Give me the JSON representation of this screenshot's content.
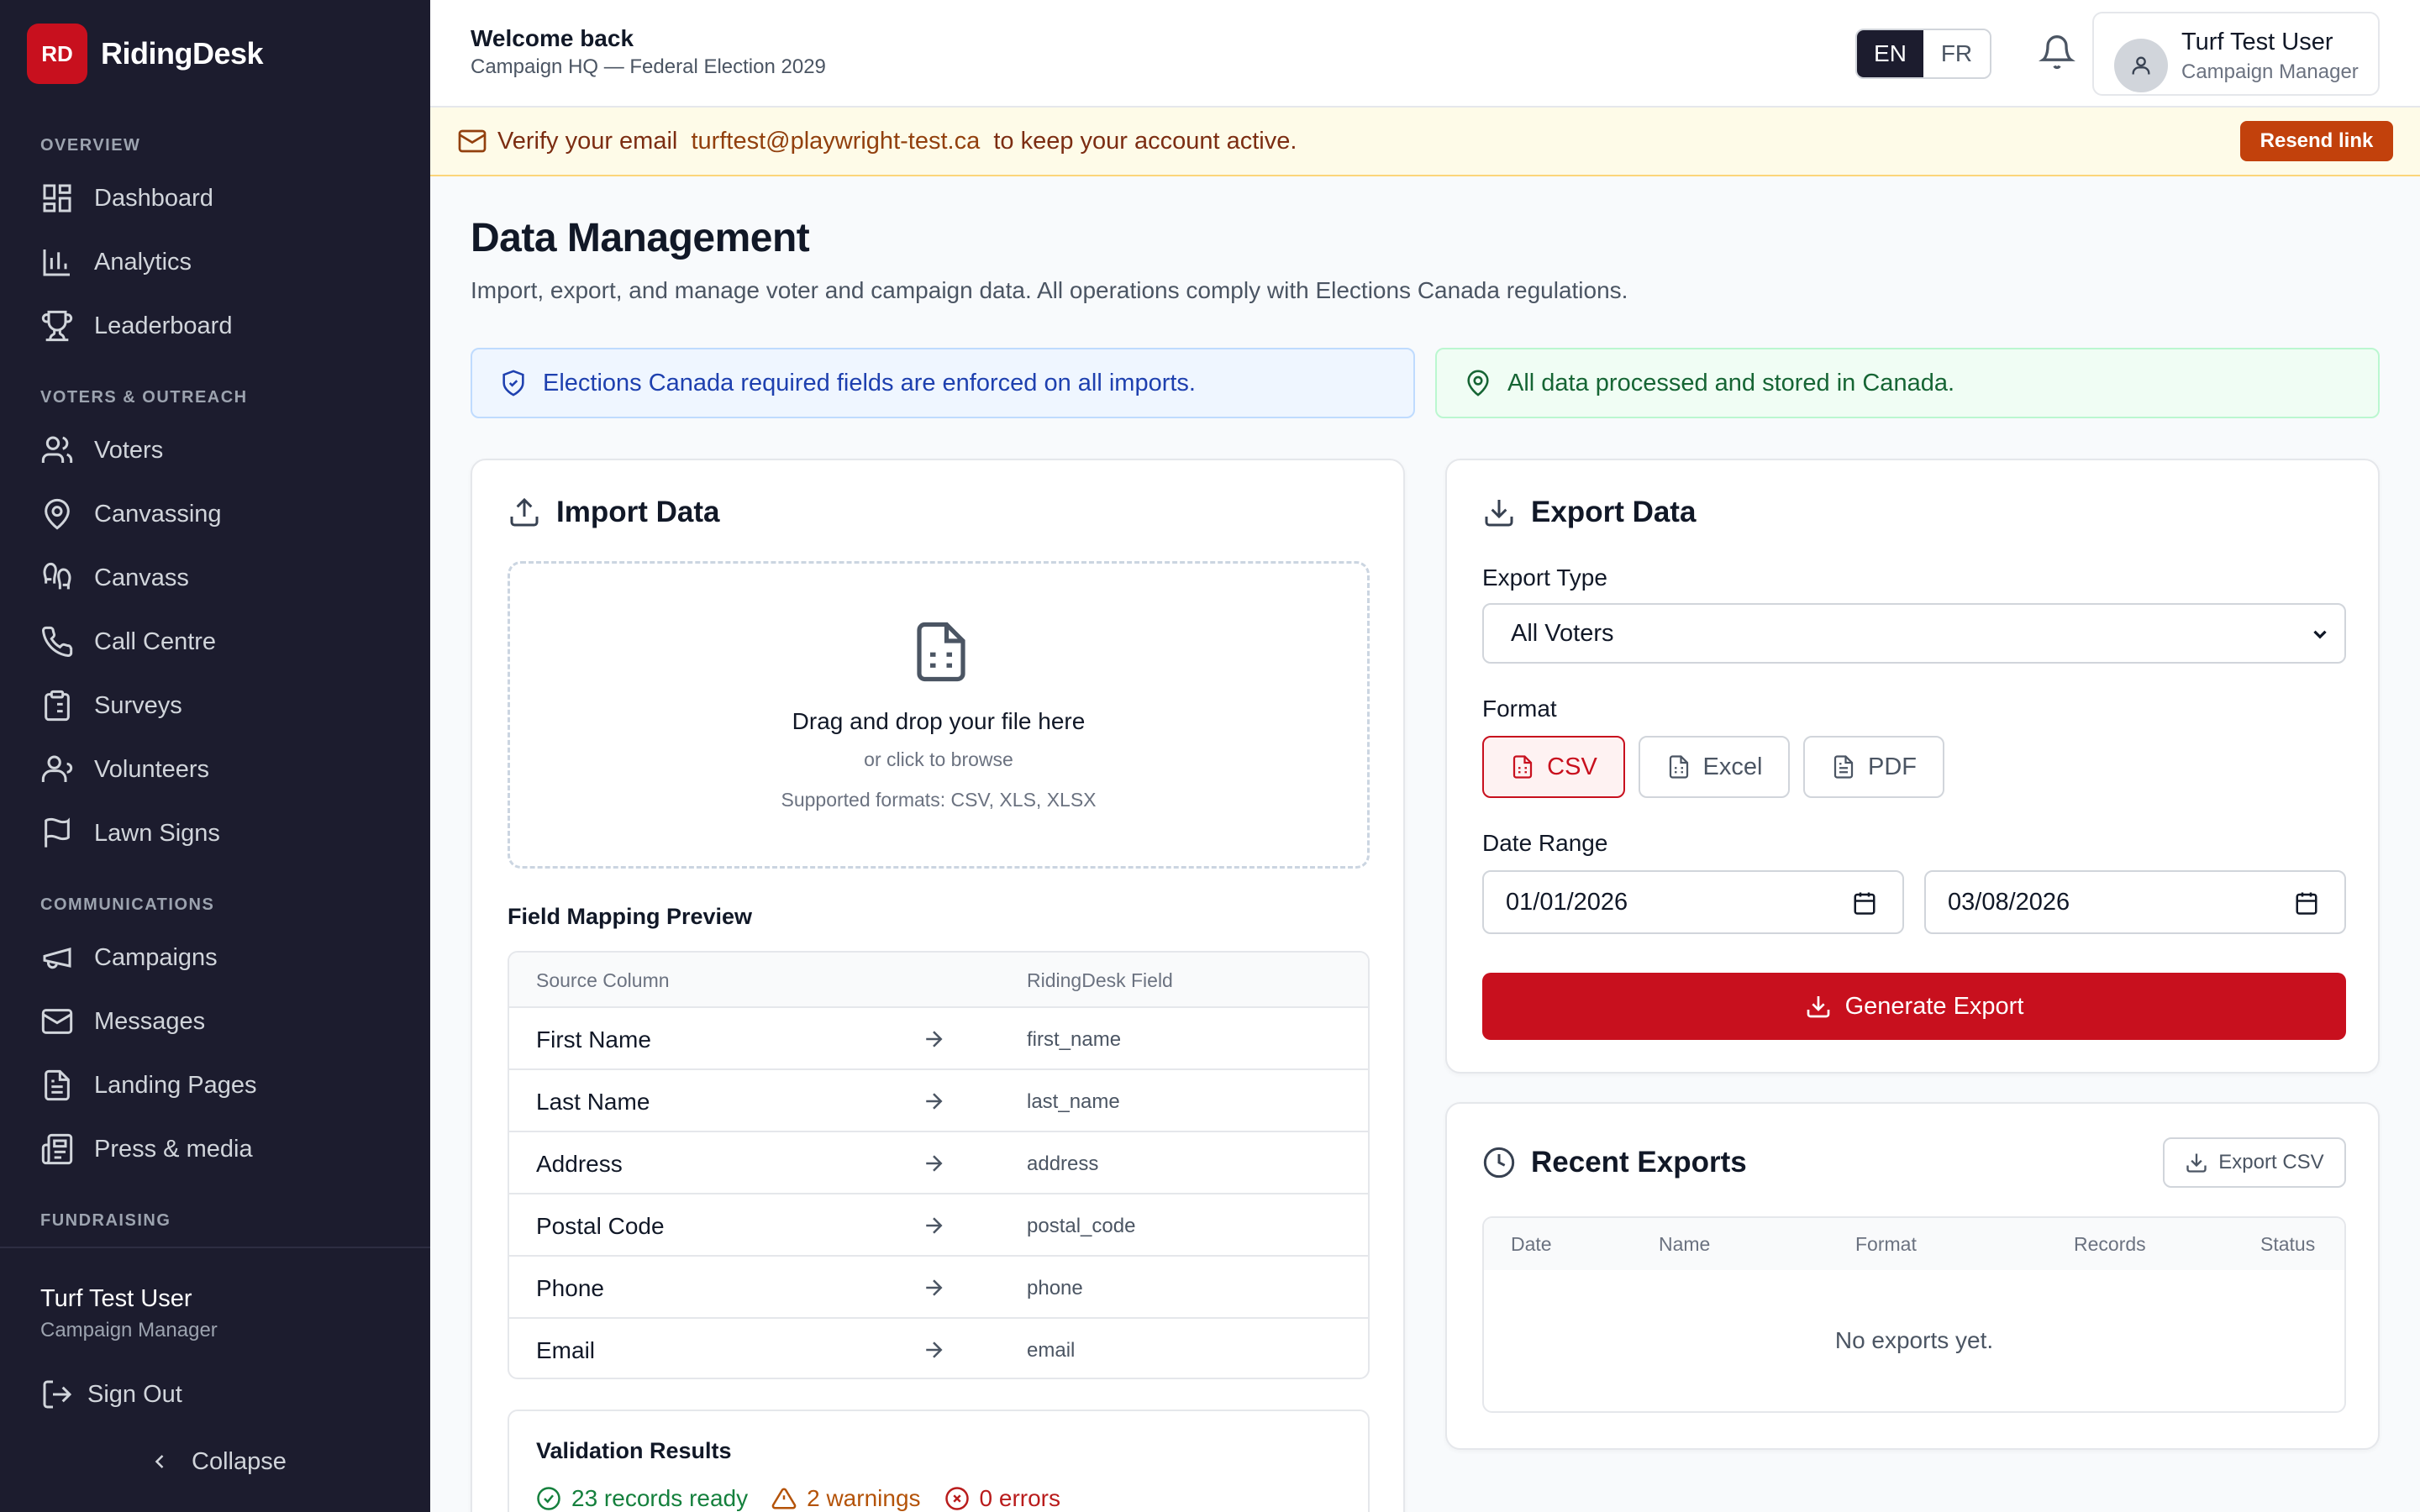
{
  "brand": {
    "logo_text": "RD",
    "name": "RidingDesk",
    "accent": "#c8101e"
  },
  "sidebar": {
    "sections": [
      {
        "label": "OVERVIEW"
      },
      {
        "label": "VOTERS & OUTREACH"
      },
      {
        "label": "COMMUNICATIONS"
      },
      {
        "label": "FUNDRAISING"
      }
    ],
    "items": [
      {
        "label": "Dashboard",
        "icon": "dashboard-icon"
      },
      {
        "label": "Analytics",
        "icon": "bar-chart-icon"
      },
      {
        "label": "Leaderboard",
        "icon": "trophy-icon"
      },
      {
        "label": "Voters",
        "icon": "users-icon"
      },
      {
        "label": "Canvassing",
        "icon": "map-pin-icon"
      },
      {
        "label": "Canvass",
        "icon": "footprints-icon"
      },
      {
        "label": "Call Centre",
        "icon": "phone-icon"
      },
      {
        "label": "Surveys",
        "icon": "clipboard-icon"
      },
      {
        "label": "Volunteers",
        "icon": "user-icon"
      },
      {
        "label": "Lawn Signs",
        "icon": "flag-icon"
      },
      {
        "label": "Campaigns",
        "icon": "megaphone-icon"
      },
      {
        "label": "Messages",
        "icon": "mail-icon"
      },
      {
        "label": "Landing Pages",
        "icon": "file-icon"
      },
      {
        "label": "Press & media",
        "icon": "newspaper-icon"
      }
    ],
    "user": {
      "name": "Turf Test User",
      "role": "Campaign Manager"
    },
    "sign_out": "Sign Out",
    "collapse": "Collapse"
  },
  "header": {
    "welcome": "Welcome back",
    "subtitle": "Campaign HQ — Federal Election 2029",
    "lang": {
      "en": "EN",
      "fr": "FR",
      "selected": "EN"
    },
    "user": {
      "name": "Turf Test User",
      "role": "Campaign Manager"
    }
  },
  "banner": {
    "prefix": "Verify your email ",
    "email": "turftest@playwright-test.ca",
    "suffix": " to keep your account active.",
    "button": "Resend link"
  },
  "main": {
    "title": "Data Management",
    "description": "Import, export, and manage voter and campaign data. All operations comply with Elections Canada regulations.",
    "notices": [
      {
        "text": "Elections Canada required fields are enforced on all imports.",
        "icon": "shield-check-icon"
      },
      {
        "text": "All data processed and stored in Canada.",
        "icon": "map-pin-icon"
      }
    ]
  },
  "import": {
    "title": "Import Data",
    "dropzone": {
      "title": "Drag and drop your file here",
      "sub": "or click to browse",
      "formats": "Supported formats: CSV, XLS, XLSX"
    },
    "field_mapping": {
      "title": "Field Mapping Preview",
      "headers": [
        "Source Column",
        "RidingDesk Field"
      ],
      "rows": [
        {
          "source": "First Name",
          "field": "first_name"
        },
        {
          "source": "Last Name",
          "field": "last_name"
        },
        {
          "source": "Address",
          "field": "address"
        },
        {
          "source": "Postal Code",
          "field": "postal_code"
        },
        {
          "source": "Phone",
          "field": "phone"
        },
        {
          "source": "Email",
          "field": "email"
        }
      ]
    },
    "validation": {
      "title": "Validation Results",
      "ready": "23 records ready",
      "warnings": "2 warnings",
      "errors": "0 errors"
    }
  },
  "export": {
    "title": "Export Data",
    "type_label": "Export Type",
    "type_value": "All Voters",
    "format_label": "Format",
    "formats": [
      "CSV",
      "Excel",
      "PDF"
    ],
    "selected_format": "CSV",
    "date_label": "Date Range",
    "date_from": "01/01/2026",
    "date_to": "03/08/2026",
    "generate": "Generate Export"
  },
  "recent": {
    "title": "Recent Exports",
    "export_csv": "Export CSV",
    "headers": [
      "Date",
      "Name",
      "Format",
      "Records",
      "Status"
    ],
    "empty": "No exports yet."
  }
}
